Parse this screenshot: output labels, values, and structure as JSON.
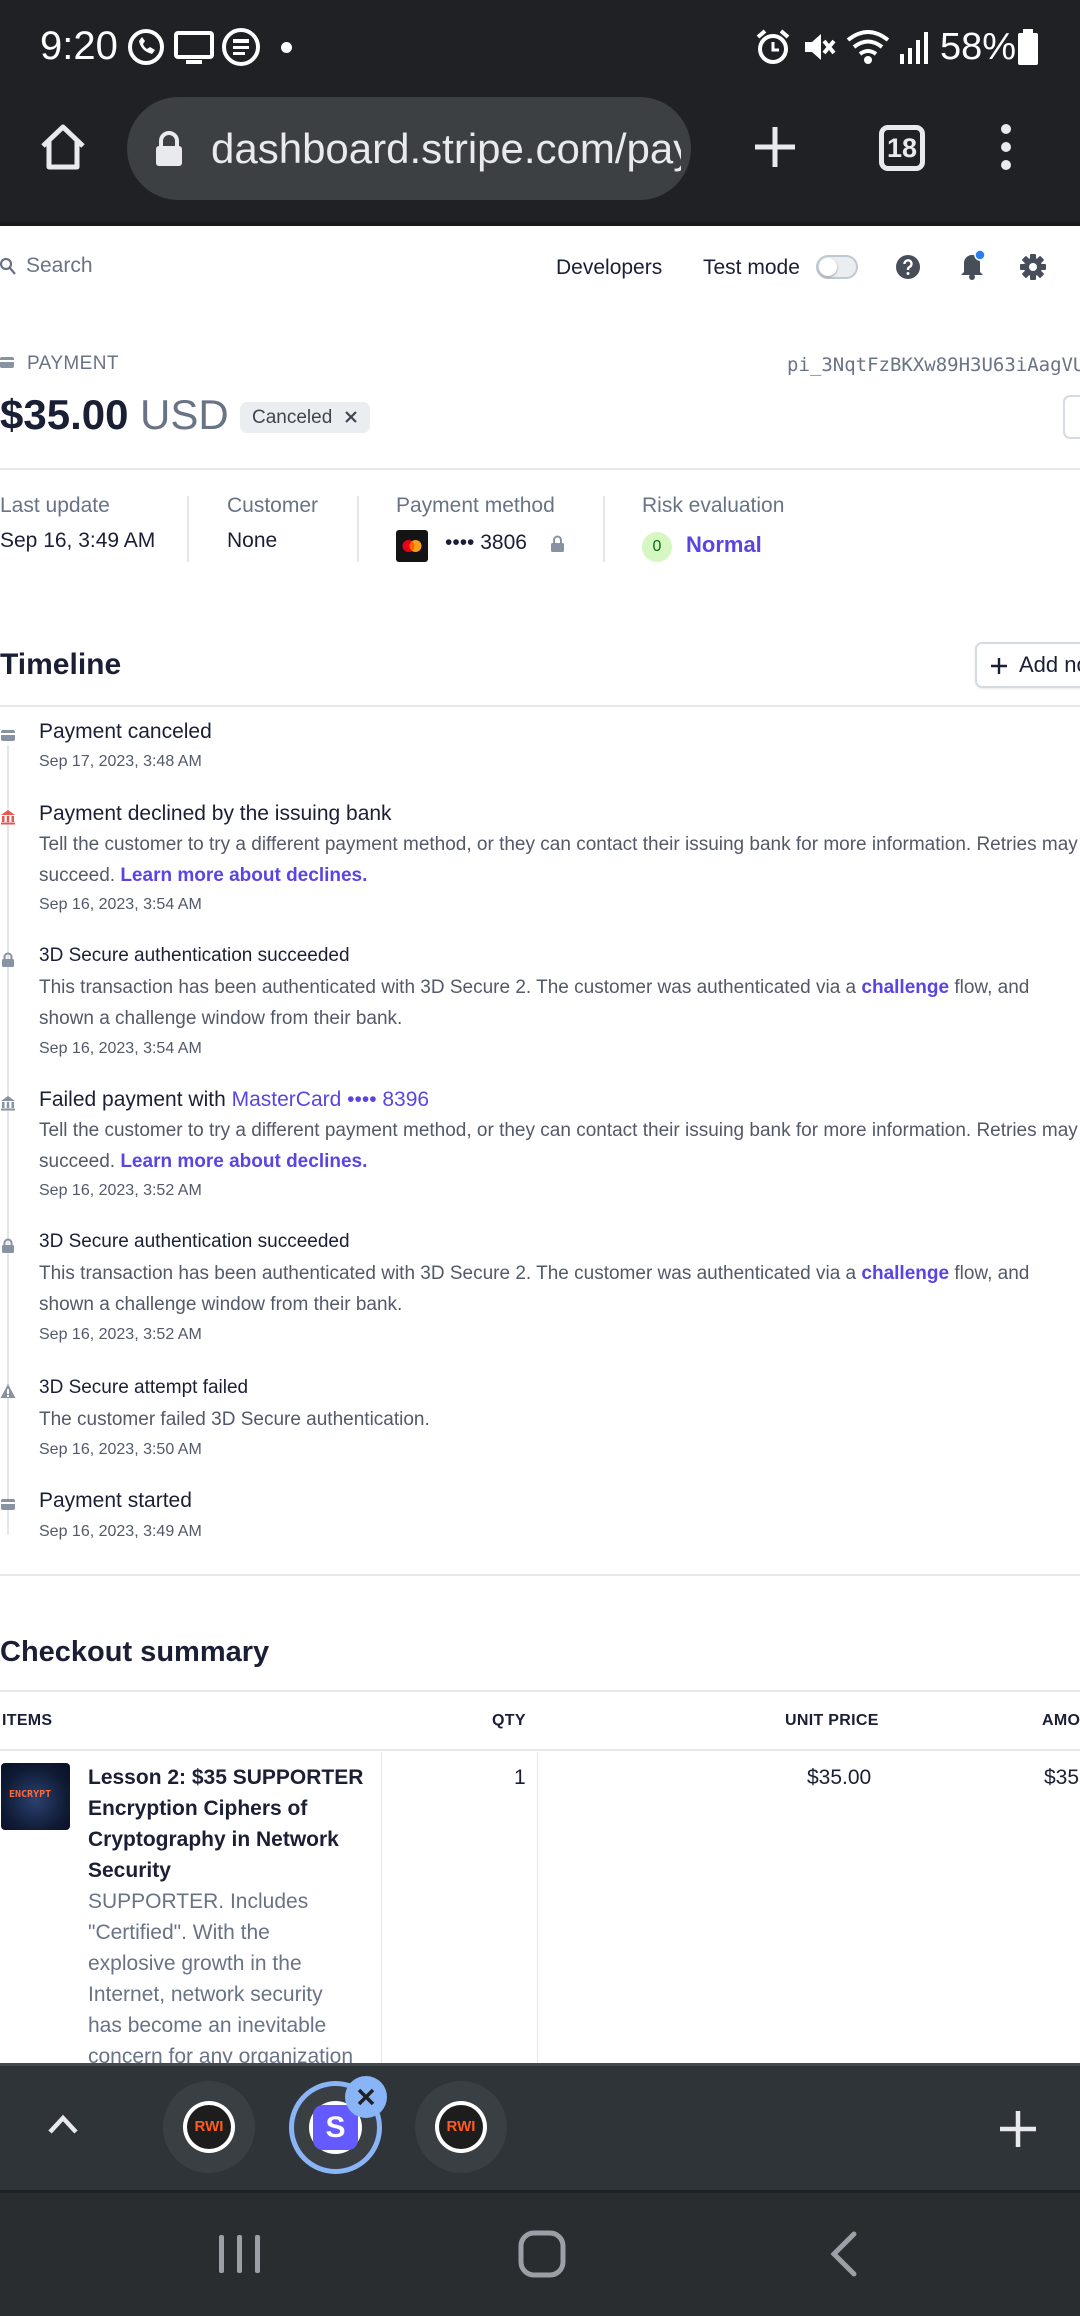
{
  "status_bar": {
    "time": "9:20",
    "battery": "58%"
  },
  "browser": {
    "url": "dashboard.stripe.com/payr",
    "tab_count": "18"
  },
  "header": {
    "search_label": "Search",
    "developers": "Developers",
    "test_mode": "Test mode"
  },
  "payment": {
    "section_label": "PAYMENT",
    "id": "pi_3NqtFzBKXw89H3U63iAagVU",
    "amount": "$35.00",
    "currency": "USD",
    "status": "Canceled"
  },
  "summary": {
    "last_update_label": "Last update",
    "last_update_value": "Sep 16, 3:49 AM",
    "customer_label": "Customer",
    "customer_value": "None",
    "payment_method_label": "Payment method",
    "payment_method_value": "•••• 3806",
    "risk_label": "Risk evaluation",
    "risk_score": "0",
    "risk_value": "Normal"
  },
  "timeline": {
    "title": "Timeline",
    "add_note": "Add no",
    "learn_more": "Learn more about declines.",
    "challenge_link": "challenge",
    "events": [
      {
        "title": "Payment canceled",
        "date": "Sep 17, 2023, 3:48 AM"
      },
      {
        "title": "Payment declined by the issuing bank",
        "desc": "Tell the customer to try a different payment method, or they can contact their issuing bank for more information. Retries may succeed.",
        "date": "Sep 16, 2023, 3:54 AM"
      },
      {
        "title": "3D Secure authentication succeeded",
        "desc_pre": "This transaction has been authenticated with 3D Secure 2. The customer was authenticated via a",
        "desc_post": "flow, and shown a challenge window from their bank.",
        "date": "Sep 16, 2023, 3:54 AM"
      },
      {
        "title": "Failed payment with",
        "card_link": "MasterCard •••• 8396",
        "desc": "Tell the customer to try a different payment method, or they can contact their issuing bank for more information. Retries may succeed.",
        "date": "Sep 16, 2023, 3:52 AM"
      },
      {
        "title": "3D Secure authentication succeeded",
        "desc_pre": "This transaction has been authenticated with 3D Secure 2. The customer was authenticated via a",
        "desc_post": "flow, and shown a challenge window from their bank.",
        "date": "Sep 16, 2023, 3:52 AM"
      },
      {
        "title": "3D Secure attempt failed",
        "desc": "The customer failed 3D Secure authentication.",
        "date": "Sep 16, 2023, 3:50 AM"
      },
      {
        "title": "Payment started",
        "date": "Sep 16, 2023, 3:49 AM"
      }
    ]
  },
  "checkout": {
    "title": "Checkout summary",
    "columns": {
      "items": "ITEMS",
      "qty": "QTY",
      "unit_price": "UNIT PRICE",
      "amount": "AMO"
    },
    "item": {
      "thumb_text": "ENCRYPT",
      "name_lines": [
        "Lesson 2: $35 SUPPORTER",
        "Encryption Ciphers of",
        "Cryptography in Network",
        "Security"
      ],
      "desc_lines": [
        "SUPPORTER. Includes",
        "\"Certified\". With the",
        "explosive growth in the",
        "Internet, network security",
        "has become an inevitable",
        "concern for any organization"
      ],
      "qty": "1",
      "unit_price": "$35.00",
      "amount": "$35"
    }
  },
  "tab_strip": {
    "tab1_label": "RWI",
    "tab2_label": "S",
    "tab3_label": "RWI"
  }
}
